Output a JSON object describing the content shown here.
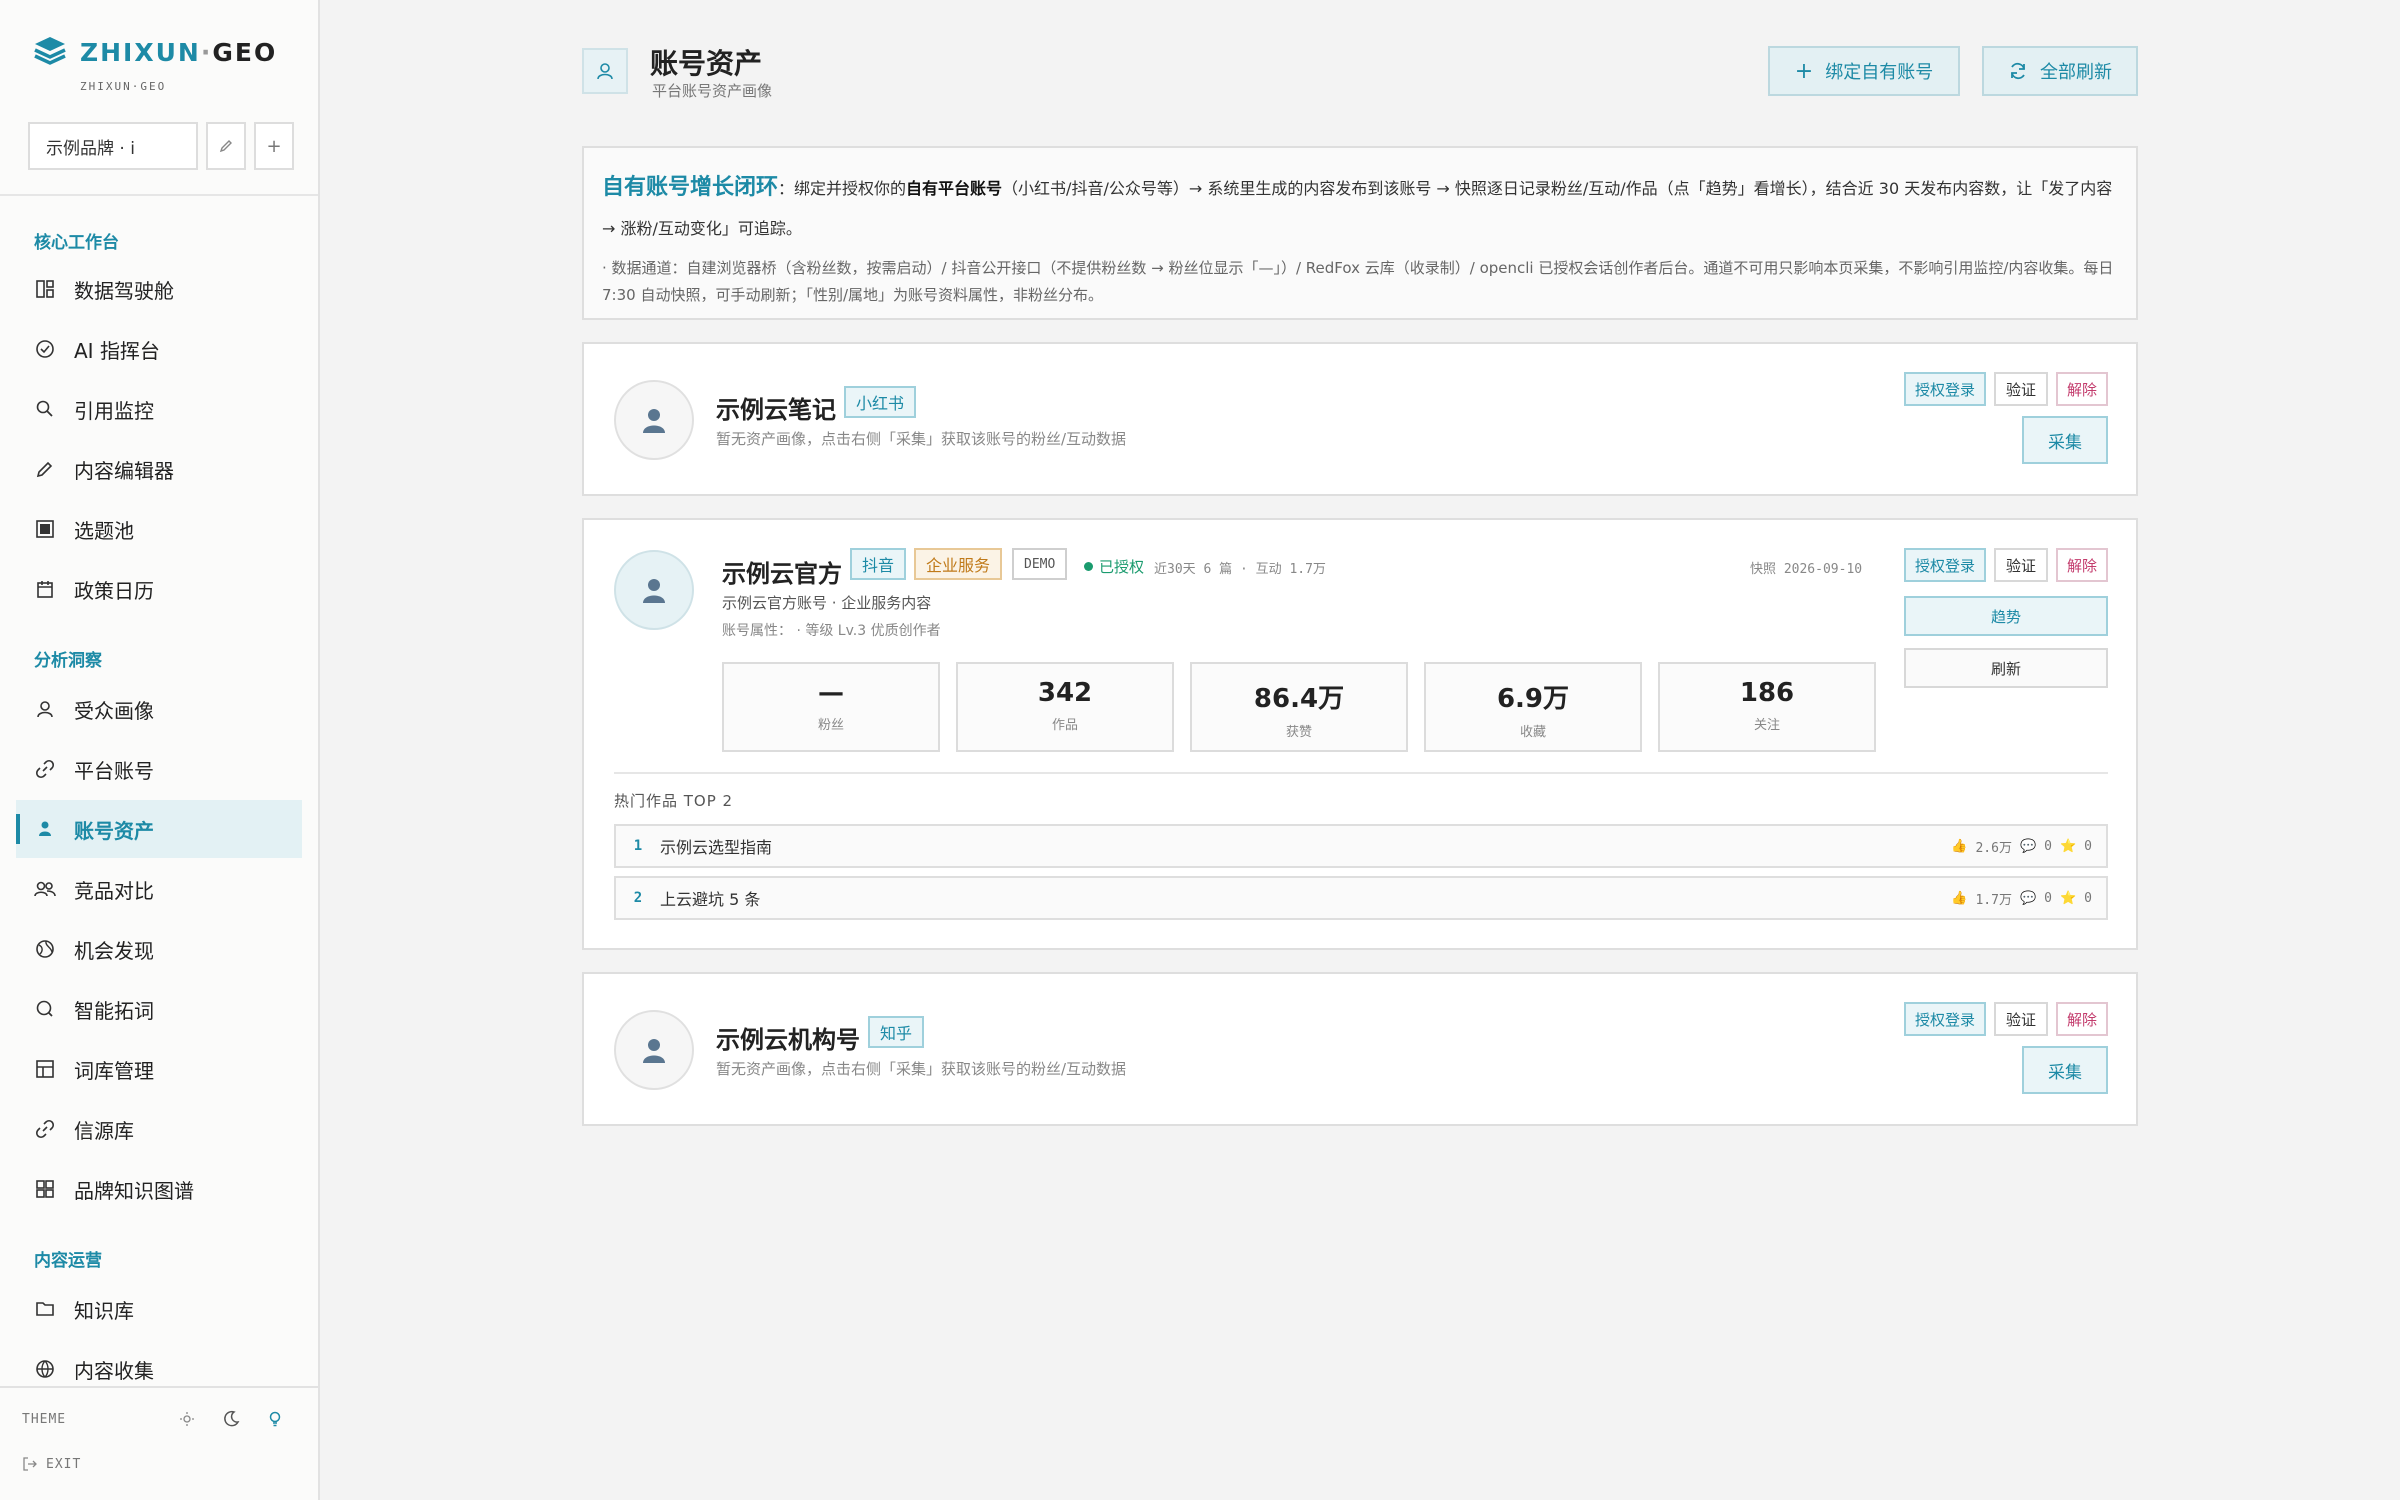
{
  "sidebar": {
    "logo_main": "ZHIXUN",
    "logo_dot": "·",
    "logo_geo": "GEO",
    "logo_sub": "ZHIXUN·GEO",
    "brand_value": "示例品牌 · i",
    "groups": [
      {
        "title": "核心工作台",
        "items": [
          "数据驾驶舱",
          "AI 指挥台",
          "引用监控",
          "内容编辑器",
          "选题池",
          "政策日历"
        ]
      },
      {
        "title": "分析洞察",
        "items": [
          "受众画像",
          "平台账号",
          "账号资产",
          "竞品对比",
          "机会发现",
          "智能拓词",
          "词库管理",
          "信源库",
          "品牌知识图谱"
        ]
      },
      {
        "title": "内容运营",
        "items": [
          "知识库",
          "内容收集"
        ]
      }
    ],
    "active_item": "账号资产",
    "theme_label": "THEME",
    "exit_label": "EXIT"
  },
  "header": {
    "title": "账号资产",
    "subtitle": "平台账号资产画像",
    "bind_button": "绑定自有账号",
    "refresh_all_button": "全部刷新"
  },
  "info": {
    "headline": "自有账号增长闭环",
    "line1_a": "：绑定并授权你的",
    "line1_b": "自有平台账号",
    "line1_c": "（小红书/抖音/公众号等）→ 系统里生成的内容发布到该账号 → 快照逐日记录粉丝/互动/作品（点「趋势」看增长），结合近 30 天发布内容数，让「发了内容 → 涨粉/互动变化」可追踪。",
    "line2": "· 数据通道：自建浏览器桥（含粉丝数，按需启动）/ 抖音公开接口（不提供粉丝数 → 粉丝位显示「—」）/ RedFox 云库（收录制）/ opencli 已授权会话创作者后台。通道不可用只影响本页采集，不影响引用监控/内容收集。每日 7:30 自动快照，可手动刷新；「性别/属地」为账号资料属性，非粉丝分布。"
  },
  "actions": {
    "auth_login": "授权登录",
    "verify": "验证",
    "unbind": "解除",
    "collect": "采集",
    "trend": "趋势",
    "refresh": "刷新"
  },
  "accounts": [
    {
      "name": "示例云笔记",
      "platform": "小红书",
      "empty_text": "暂无资产画像，点击右侧「采集」获取该账号的粉丝/互动数据"
    },
    {
      "name": "示例云官方",
      "platform": "抖音",
      "industry": "企业服务",
      "demo": "DEMO",
      "auth_status": "已授权",
      "recent": "近30天 6 篇 · 互动 1.7万",
      "snapshot": "快照 2026-09-10",
      "desc": "示例云官方账号 · 企业服务内容",
      "attrs": "账号属性：  · 等级 Lv.3 优质创作者",
      "stats": [
        {
          "value": "—",
          "label": "粉丝"
        },
        {
          "value": "342",
          "label": "作品"
        },
        {
          "value": "86.4万",
          "label": "获赞"
        },
        {
          "value": "6.9万",
          "label": "收藏"
        },
        {
          "value": "186",
          "label": "关注"
        }
      ],
      "top_label": "热门作品 TOP 2",
      "works": [
        {
          "index": "1",
          "title": "示例云选型指南",
          "likes": "2.6万",
          "comments": "0",
          "favs": "0"
        },
        {
          "index": "2",
          "title": "上云避坑 5 条",
          "likes": "1.7万",
          "comments": "0",
          "favs": "0"
        }
      ]
    },
    {
      "name": "示例云机构号",
      "platform": "知乎",
      "empty_text": "暂无资产画像，点击右侧「采集」获取该账号的粉丝/互动数据"
    }
  ],
  "colors": {
    "accent": "#1d8aa6",
    "danger": "#c33b6c",
    "warning": "#c07a1a",
    "success": "#1a9b6e"
  }
}
